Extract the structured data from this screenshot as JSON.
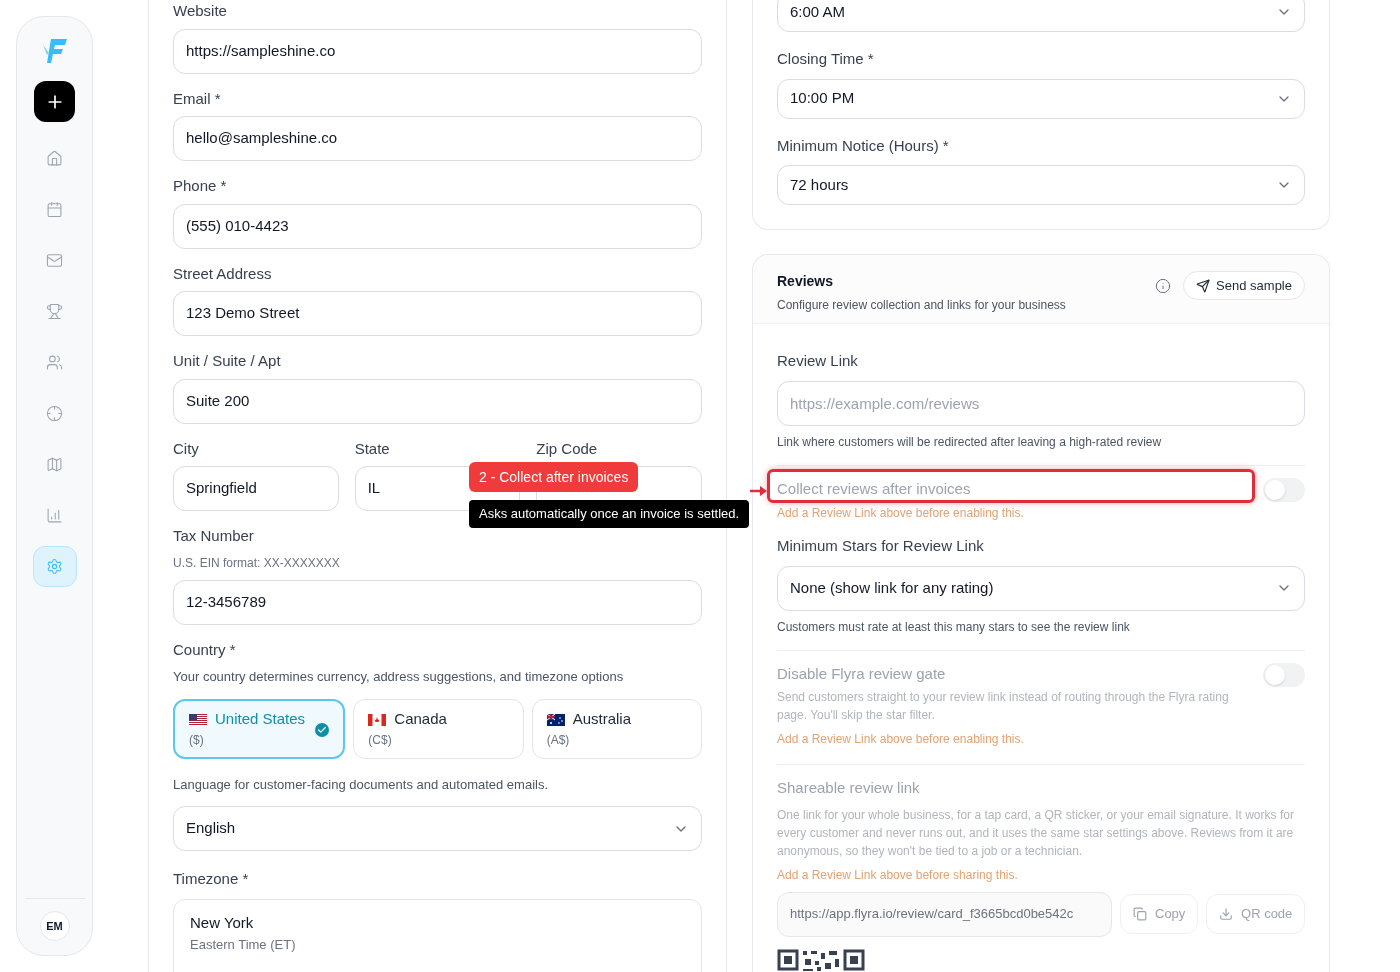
{
  "sidebar": {
    "items": [
      {
        "kind": "home",
        "selected": false
      },
      {
        "kind": "calendar",
        "selected": false
      },
      {
        "kind": "mail",
        "selected": false
      },
      {
        "kind": "trophy",
        "selected": false
      },
      {
        "kind": "users",
        "selected": false
      },
      {
        "kind": "crosshair",
        "selected": false
      },
      {
        "kind": "map",
        "selected": false
      },
      {
        "kind": "chart",
        "selected": false
      },
      {
        "kind": "settings",
        "selected": true
      }
    ],
    "avatar": "EM"
  },
  "business_form": {
    "fields": [
      {
        "label": "Website",
        "value": "https://sampleshine.co"
      },
      {
        "label": "Email *",
        "value": "hello@sampleshine.co"
      },
      {
        "label": "Phone *",
        "value": "(555) 010-4423"
      },
      {
        "label": "Street Address",
        "value": "123 Demo Street"
      },
      {
        "label": "Unit / Suite / Apt",
        "value": "Suite 200"
      }
    ],
    "address_row": [
      {
        "label": "City",
        "value": "Springfield"
      },
      {
        "label": "State",
        "value": "IL"
      },
      {
        "label": "Zip Code"
      }
    ],
    "tax": {
      "label": "Tax Number",
      "hint": "U.S. EIN format: XX-XXXXXXX",
      "value": "12-3456789"
    },
    "country": {
      "label": "Country *",
      "hint": "Your country determines currency, address suggestions, and timezone options",
      "options": [
        {
          "kind": "us",
          "name": "United States",
          "currency": "($)",
          "selected": true
        },
        {
          "kind": "ca",
          "name": "Canada",
          "currency": "(C$)",
          "selected": false
        },
        {
          "kind": "au",
          "name": "Australia",
          "currency": "(A$)",
          "selected": false
        }
      ]
    },
    "language": {
      "hint": "Language for customer-facing documents and automated emails.",
      "value": "English"
    },
    "timezone": {
      "label": "Timezone *",
      "city": "New York",
      "zone": "Eastern Time (ET)"
    }
  },
  "hours": {
    "selects": [
      {
        "value": "6:00 AM"
      },
      {
        "label": "Closing Time *",
        "value": "10:00 PM"
      },
      {
        "label": "Minimum Notice (Hours) *",
        "value": "72 hours"
      }
    ]
  },
  "reviews": {
    "title": "Reviews",
    "subtitle": "Configure review collection and links for your business",
    "send_button": "Send sample",
    "review_link": {
      "label": "Review Link",
      "placeholder": "https://example.com/reviews",
      "hint": "Link where customers will be redirected after leaving a high-rated review"
    },
    "collect": {
      "label": "Collect reviews after invoices",
      "on": false,
      "disabled": true,
      "warning": "Add a Review Link above before enabling this."
    },
    "min_stars": {
      "label": "Minimum Stars for Review Link",
      "value": "None (show link for any rating)",
      "hint": "Customers must rate at least this many stars to see the review link"
    },
    "disable_gate": {
      "label": "Disable Flyra review gate",
      "on": false,
      "disabled": true,
      "description": "Send customers straight to your review link instead of routing through the Flyra rating page. You'll skip the star filter.",
      "warning": "Add a Review Link above before enabling this."
    },
    "shareable": {
      "title": "Shareable review link",
      "description": "One link for your whole business, for a tap card, a QR sticker, or your email signature. It works for every customer and never runs out, and it uses the same star settings above. Reviews from it are anonymous, so they won't be tied to a job or a technician.",
      "warning": "Add a Review Link above before sharing this.",
      "url": "https://app.flyra.io/review/card_f3665bcd0be542c",
      "copy": "Copy",
      "qr": "QR code"
    }
  },
  "annotation": {
    "tag": "2 - Collect after invoices",
    "tooltip": "Asks automatically once an invoice is settled."
  }
}
